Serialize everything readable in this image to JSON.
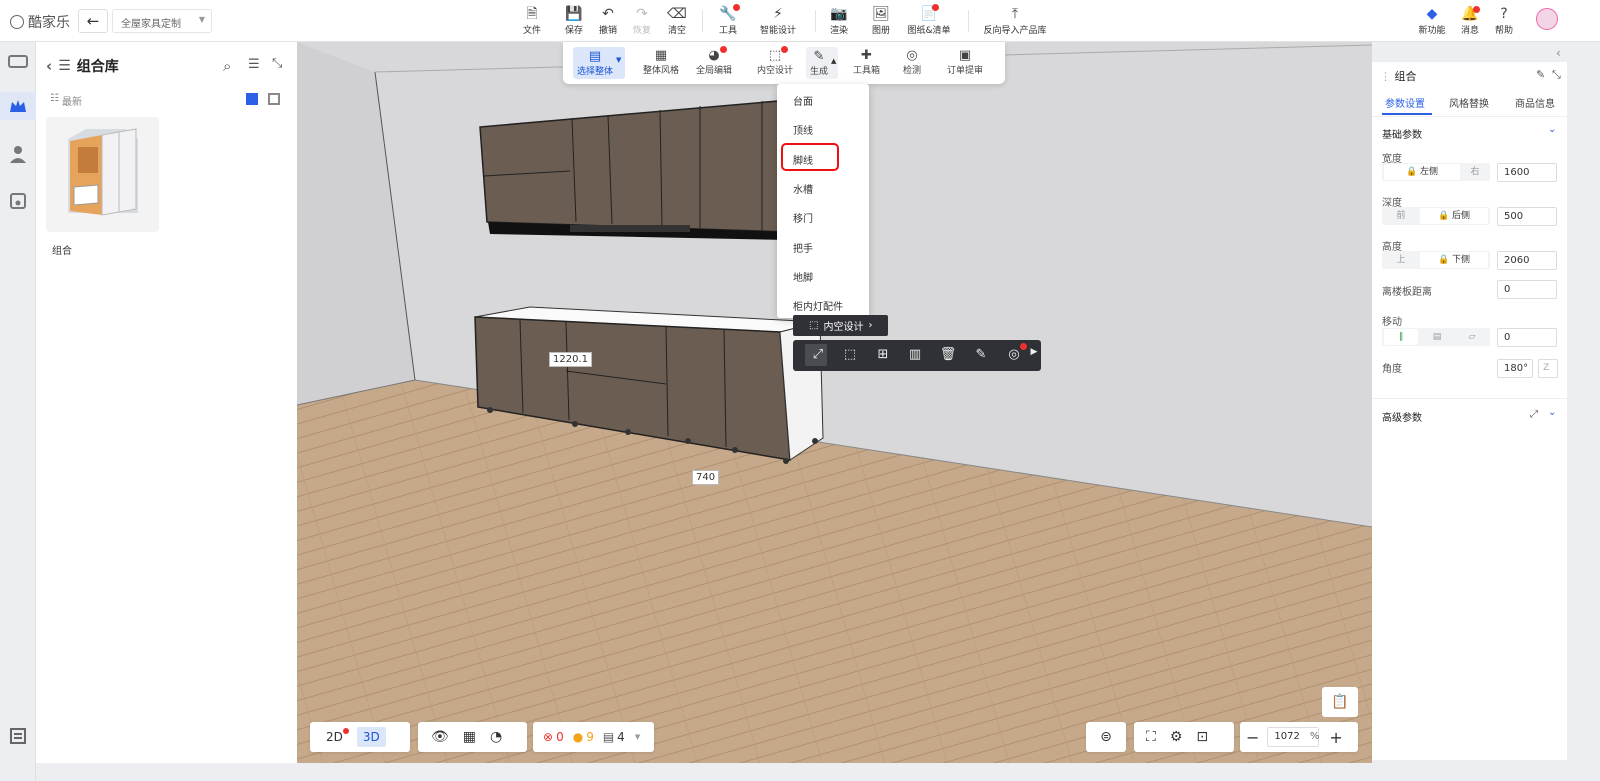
{
  "app": {
    "logo": "酷家乐",
    "project_selector": "全屋家具定制"
  },
  "toolbar": {
    "items": [
      {
        "label": "文件",
        "icon": "file-icon"
      },
      {
        "label": "保存",
        "icon": "save-icon"
      },
      {
        "label": "撤销",
        "icon": "undo-icon"
      },
      {
        "label": "恢复",
        "icon": "redo-icon"
      },
      {
        "label": "清空",
        "icon": "eraser-icon"
      },
      {
        "label": "工具",
        "icon": "wrench-icon"
      },
      {
        "label": "智能设计",
        "icon": "lightning-icon"
      },
      {
        "label": "渲染",
        "icon": "camera-icon"
      },
      {
        "label": "图册",
        "icon": "album-icon"
      },
      {
        "label": "图纸&清单",
        "icon": "document-icon"
      },
      {
        "label": "反向导入产品库",
        "icon": "import-icon"
      }
    ],
    "right": [
      {
        "label": "新功能",
        "icon": "new-feature-icon"
      },
      {
        "label": "消息",
        "icon": "bell-icon"
      },
      {
        "label": "帮助",
        "icon": "help-icon"
      }
    ]
  },
  "left_panel": {
    "title": "组合库",
    "filter": "最新",
    "items": [
      {
        "label": "组合"
      }
    ]
  },
  "float_toolbar": [
    {
      "label": "选择整体"
    },
    {
      "label": "整体风格"
    },
    {
      "label": "全局编辑"
    },
    {
      "label": "内空设计"
    },
    {
      "label": "生成"
    },
    {
      "label": "工具箱"
    },
    {
      "label": "检测"
    },
    {
      "label": "订单提审"
    }
  ],
  "dropdown": {
    "items": [
      "台面",
      "顶线",
      "脚线",
      "水槽",
      "移门",
      "把手",
      "地脚",
      "柜内灯配件"
    ],
    "highlighted": "脚线"
  },
  "context_bar": {
    "label": "内空设计"
  },
  "dimensions": {
    "width_label": "1220.1",
    "depth_label": "740"
  },
  "bottom_left": {
    "view_2d": "2D",
    "view_3d": "3D",
    "errors": "0",
    "warnings": "9",
    "layers": "4"
  },
  "bottom_right": {
    "zoom": "1072",
    "unit": "%"
  },
  "right_panel": {
    "title": "组合",
    "tabs": [
      "参数设置",
      "风格替换",
      "商品信息"
    ],
    "section_basic": "基础参数",
    "width_label": "宽度",
    "width_left": "左侧",
    "width_right": "右",
    "width_value": "1600",
    "depth_label": "深度",
    "depth_front": "前",
    "depth_back": "后侧",
    "depth_value": "500",
    "height_label": "高度",
    "height_up": "上",
    "height_down": "下侧",
    "height_value": "2060",
    "floor_label": "离楼板距离",
    "floor_value": "0",
    "move_label": "移动",
    "move_value": "0",
    "angle_label": "角度",
    "angle_value": "180°",
    "angle_axis": "Z",
    "section_advanced": "高级参数"
  },
  "colors": {
    "accent": "#2b5fe6",
    "highlight": "#ee1111",
    "wood": "#6b5d52"
  }
}
